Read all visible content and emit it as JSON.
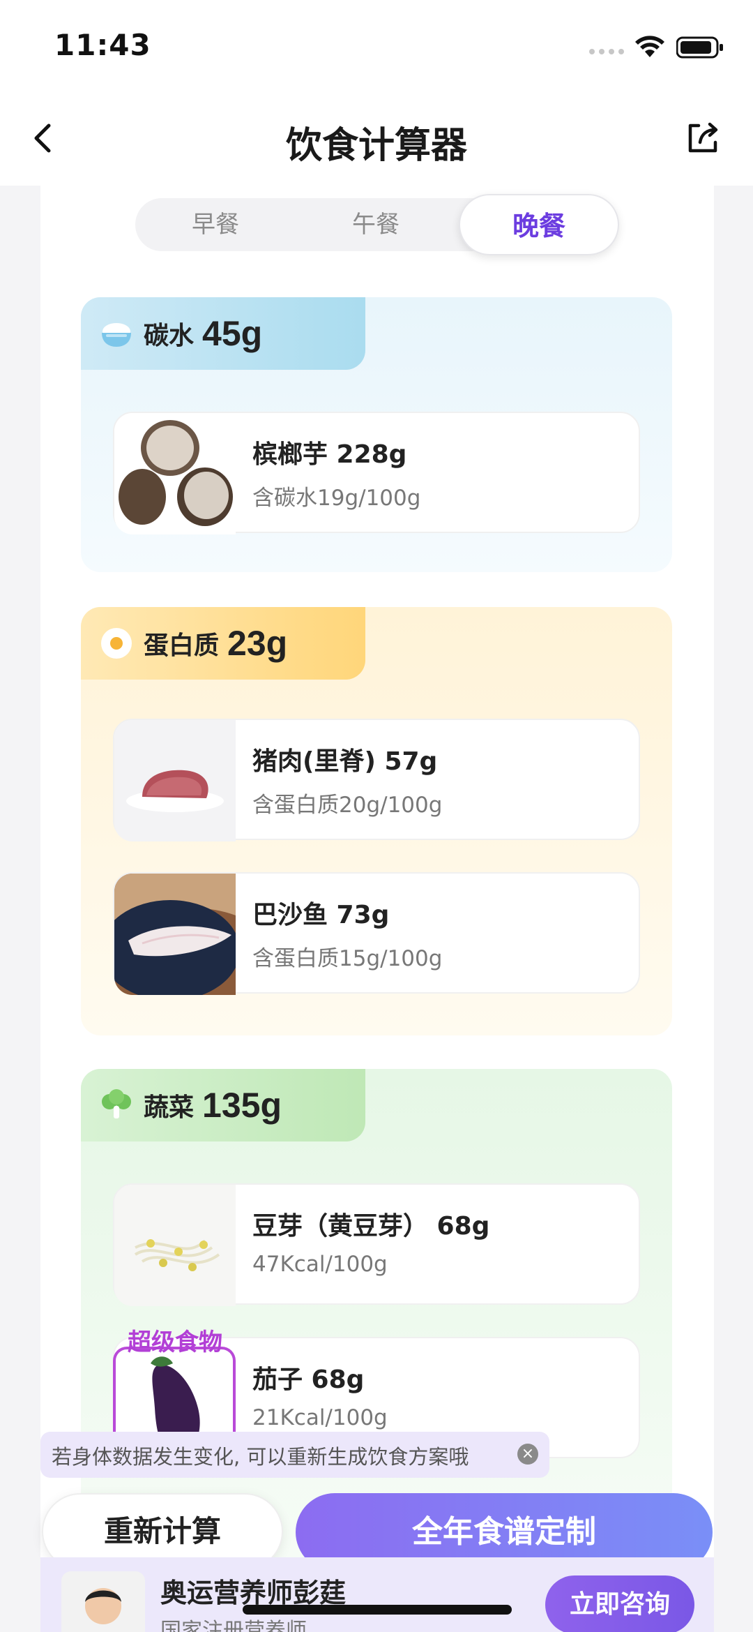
{
  "status": {
    "time": "11:43"
  },
  "nav": {
    "title": "饮食计算器"
  },
  "tabs": [
    {
      "label": "早餐"
    },
    {
      "label": "午餐"
    },
    {
      "label": "晚餐",
      "active": true
    }
  ],
  "sections": {
    "carb": {
      "label": "碳水",
      "value": "45g",
      "icon": "rice-bowl-icon",
      "items": [
        {
          "name": "槟榔芋 228g",
          "desc": "含碳水19g/100g",
          "image": "taro-image"
        }
      ]
    },
    "protein": {
      "label": "蛋白质",
      "value": "23g",
      "icon": "egg-icon",
      "items": [
        {
          "name": "猪肉(里脊) 57g",
          "desc": "含蛋白质20g/100g",
          "image": "pork-image"
        },
        {
          "name": "巴沙鱼 73g",
          "desc": "含蛋白质15g/100g",
          "image": "fish-image"
        }
      ]
    },
    "veg": {
      "label": "蔬菜",
      "value": "135g",
      "icon": "broccoli-icon",
      "items": [
        {
          "name": "豆芽（黄豆芽） 68g",
          "desc": "47Kcal/100g",
          "image": "sprouts-image"
        },
        {
          "name": "茄子 68g",
          "desc": "21Kcal/100g",
          "image": "eggplant-image",
          "badge": "超级食物"
        }
      ]
    }
  },
  "tip": {
    "text": "若身体数据发生变化, 可以重新生成饮食方案哦"
  },
  "buttons": {
    "recalc": "重新计算",
    "custom": "全年食谱定制",
    "consult": "立即咨询"
  },
  "advisor": {
    "name": "奥运营养师彭莛",
    "title": "国家注册营养师"
  },
  "colors": {
    "accent": "#6c3de0",
    "carb": "#aadcef",
    "protein": "#ffd67a",
    "veg": "#bfe8b6",
    "button_gradient": "#8c6cf1"
  }
}
